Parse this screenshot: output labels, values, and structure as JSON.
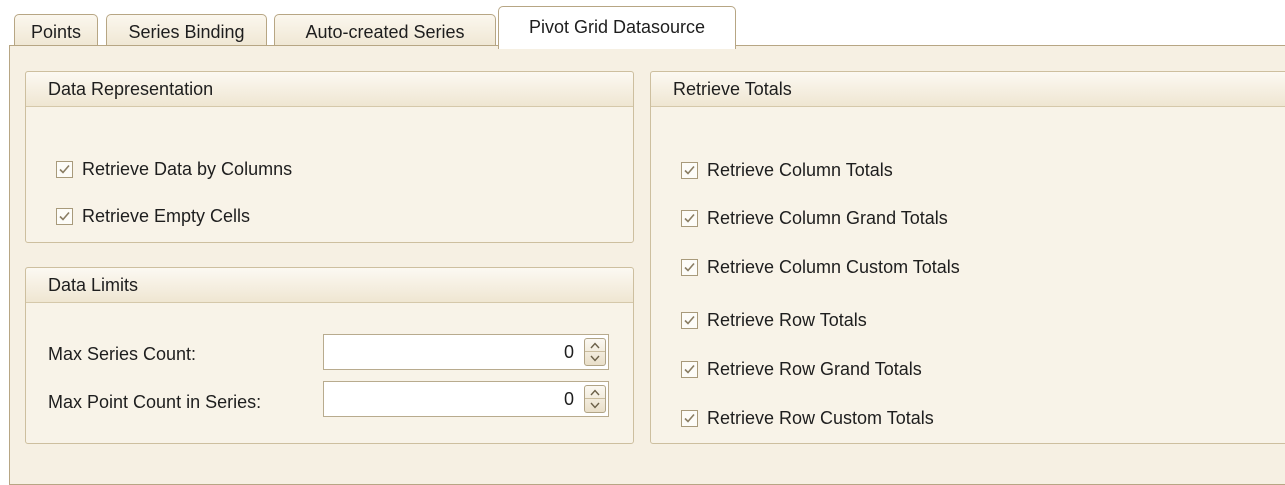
{
  "tabs": [
    {
      "label": "Points",
      "active": false
    },
    {
      "label": "Series Binding",
      "active": false
    },
    {
      "label": "Auto-created Series",
      "active": false
    },
    {
      "label": "Pivot Grid Datasource",
      "active": true
    }
  ],
  "data_representation": {
    "title": "Data Representation",
    "options": [
      {
        "label": "Retrieve Data by Columns",
        "checked": true
      },
      {
        "label": "Retrieve Empty Cells",
        "checked": true
      }
    ]
  },
  "data_limits": {
    "title": "Data Limits",
    "max_series_count": {
      "label": "Max Series Count:",
      "value": "0"
    },
    "max_point_count": {
      "label": "Max Point Count in Series:",
      "value": "0"
    }
  },
  "retrieve_totals": {
    "title": "Retrieve Totals",
    "options": [
      {
        "label": "Retrieve Column Totals",
        "checked": true
      },
      {
        "label": "Retrieve Column Grand Totals",
        "checked": true
      },
      {
        "label": "Retrieve Column Custom Totals",
        "checked": true
      },
      {
        "label": "Retrieve Row Totals",
        "checked": true
      },
      {
        "label": "Retrieve Row Grand Totals",
        "checked": true
      },
      {
        "label": "Retrieve Row Custom Totals",
        "checked": true
      }
    ]
  },
  "icons": {
    "checkbox": "checkmark-icon",
    "spin_up": "chevron-up-icon",
    "spin_down": "chevron-down-icon"
  },
  "colors": {
    "panel": "#f6f0e3",
    "border": "#b7a684",
    "check": "#8a7d63"
  }
}
